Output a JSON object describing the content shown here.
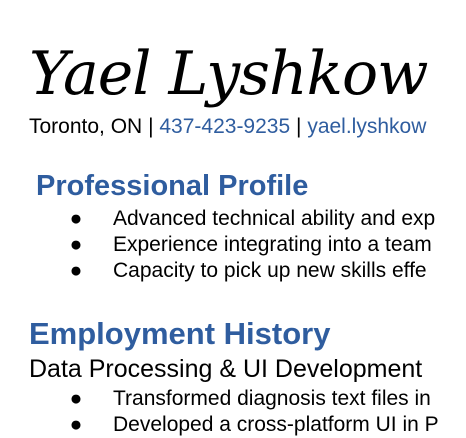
{
  "header": {
    "name": "Yael Lyshkow",
    "location": "Toronto, ON",
    "separator": "|",
    "phone": "437-423-9235",
    "email": "yael.lyshkow"
  },
  "profile": {
    "heading": "Professional Profile",
    "bullet_symbol": "●",
    "items": [
      "Advanced technical ability and exp",
      "Experience integrating into a team",
      "Capacity to pick up new skills effe"
    ]
  },
  "employment": {
    "heading": "Employment History",
    "job_title": "Data Processing & UI Development",
    "bullet_symbol": "●",
    "items": [
      "Transformed diagnosis text files in",
      "Developed a cross-platform UI in P"
    ]
  },
  "colors": {
    "accent": "#2f5d9f",
    "text": "#000000",
    "background": "#ffffff"
  }
}
